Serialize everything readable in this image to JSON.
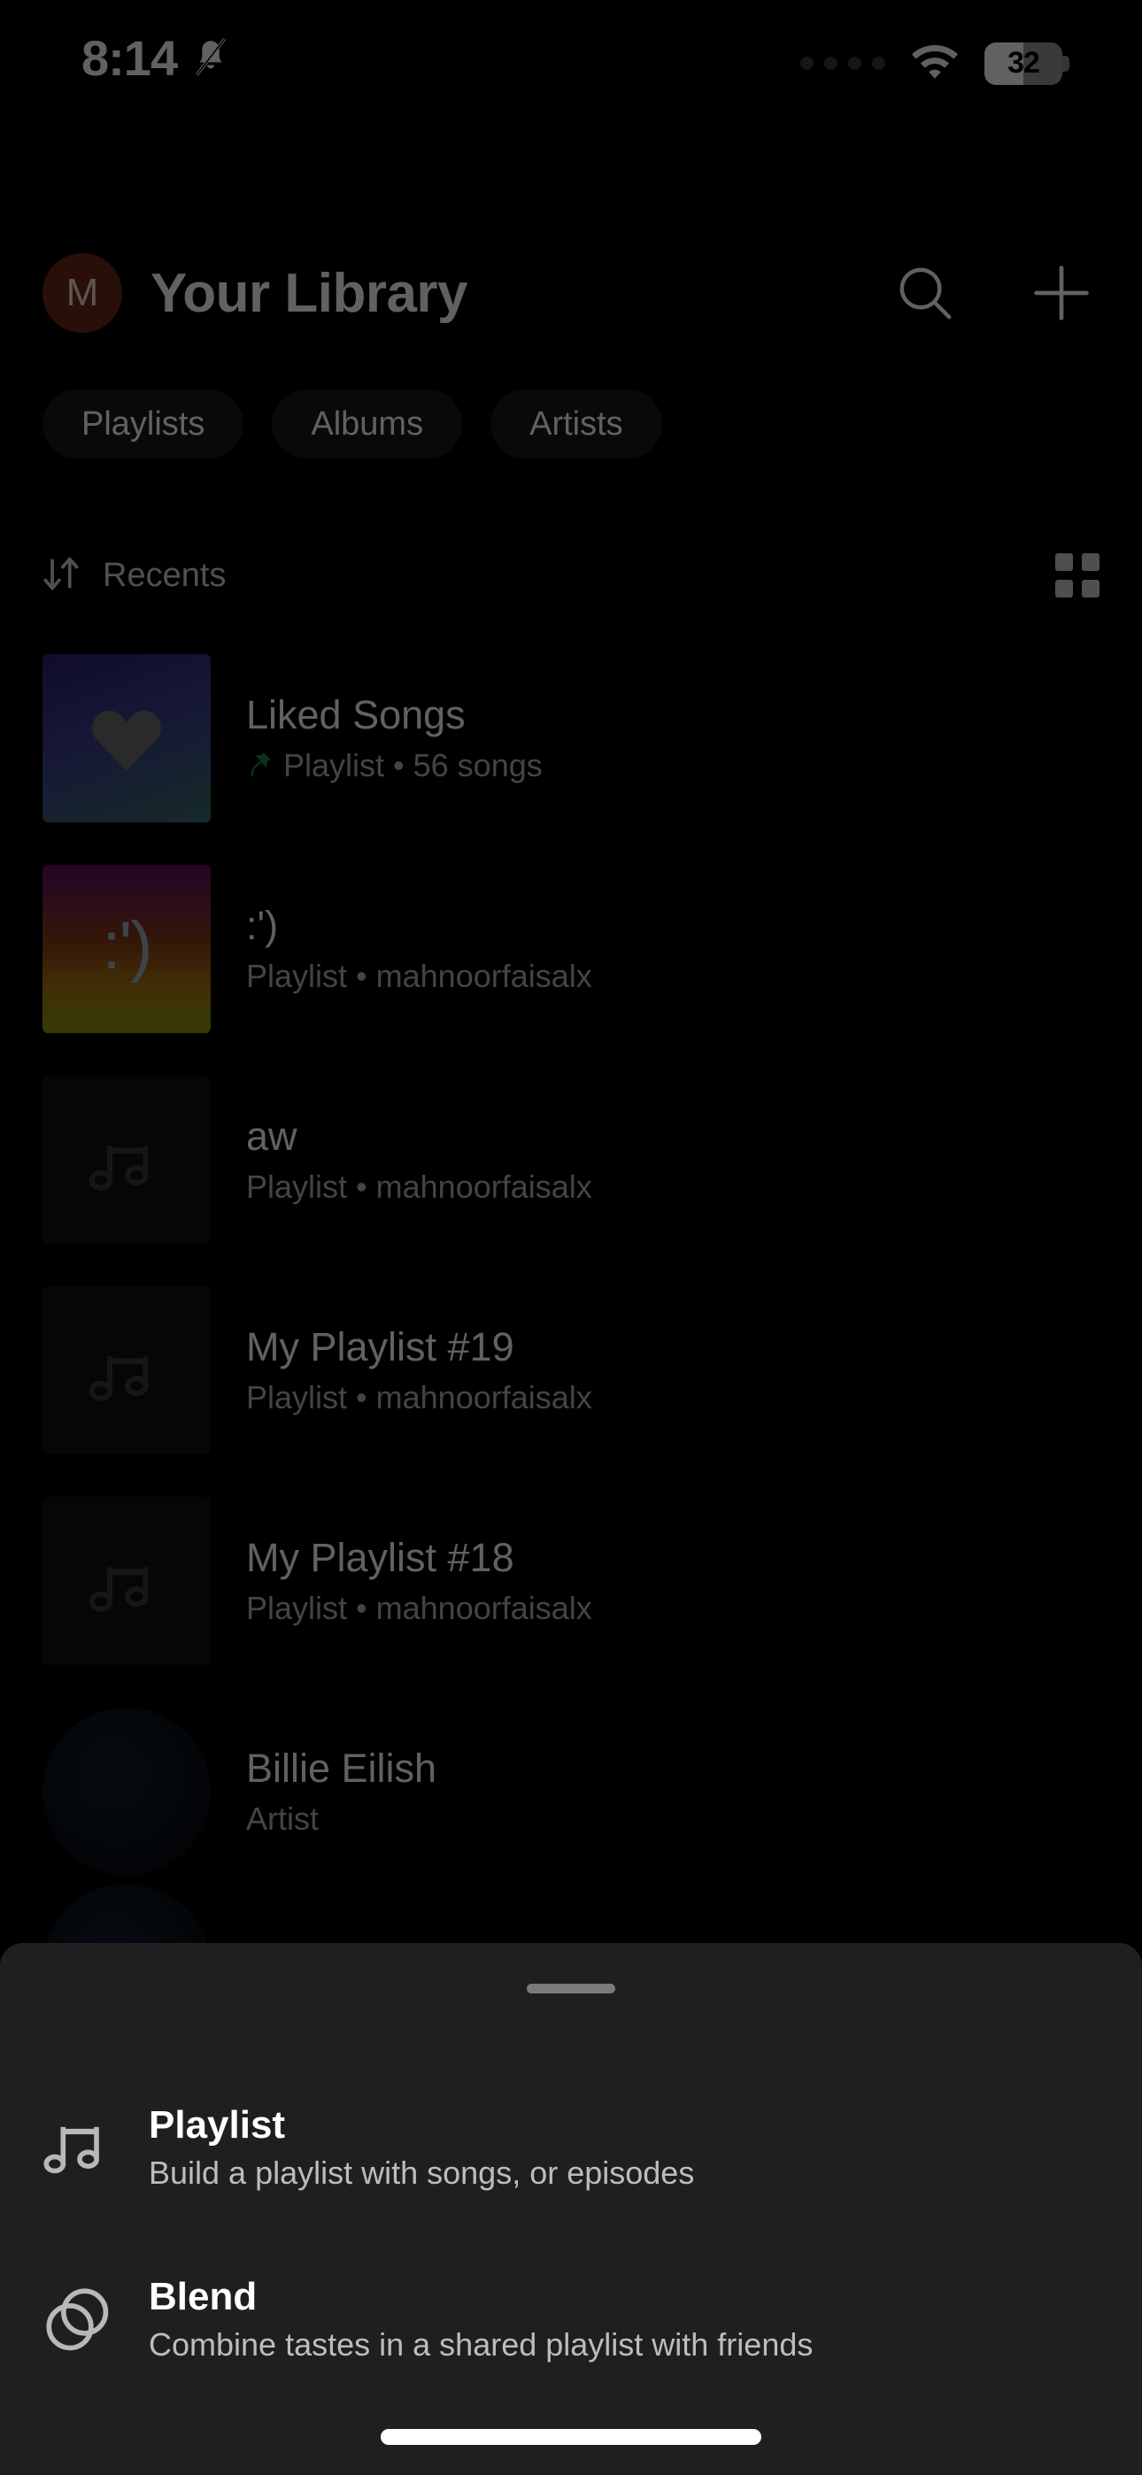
{
  "status_bar": {
    "time": "8:14",
    "bell_icon": "bell-muted-icon",
    "signal_icon": "signal-dots-icon",
    "wifi_icon": "wifi-icon",
    "battery_percent": "32"
  },
  "header": {
    "avatar_initial": "M",
    "avatar_color": "#6b2b18",
    "title": "Your Library",
    "search_icon": "search-icon",
    "add_icon": "plus-icon"
  },
  "filters": [
    {
      "label": "Playlists"
    },
    {
      "label": "Albums"
    },
    {
      "label": "Artists"
    }
  ],
  "sort": {
    "icon": "sort-arrows-icon",
    "label": "Recents",
    "view_toggle_icon": "grid-view-icon"
  },
  "library_items": [
    {
      "title": "Liked Songs",
      "subtitle": "Playlist • 56 songs",
      "pinned": true,
      "cover_type": "liked",
      "shape": "square",
      "cover_glyph": "heart-icon"
    },
    {
      "title": ":')",
      "subtitle": "Playlist • mahnoorfaisalx",
      "pinned": false,
      "cover_type": "smiley",
      "shape": "square",
      "cover_glyph": ":')"
    },
    {
      "title": "aw",
      "subtitle": "Playlist • mahnoorfaisalx",
      "pinned": false,
      "cover_type": "placeholder",
      "shape": "square",
      "cover_glyph": "music-note-icon"
    },
    {
      "title": "My Playlist #19",
      "subtitle": "Playlist • mahnoorfaisalx",
      "pinned": false,
      "cover_type": "placeholder",
      "shape": "square",
      "cover_glyph": "music-note-icon"
    },
    {
      "title": "My Playlist #18",
      "subtitle": "Playlist • mahnoorfaisalx",
      "pinned": false,
      "cover_type": "placeholder",
      "shape": "square",
      "cover_glyph": "music-note-icon"
    },
    {
      "title": "Billie Eilish",
      "subtitle": "Artist",
      "pinned": false,
      "cover_type": "artist",
      "shape": "circle",
      "cover_glyph": "artist-photo"
    }
  ],
  "sheet": {
    "grabber": "drag-handle",
    "options": [
      {
        "icon": "music-note-icon",
        "title": "Playlist",
        "description": "Build a playlist with songs, or episodes"
      },
      {
        "icon": "blend-circles-icon",
        "title": "Blend",
        "description": "Combine tastes in a shared playlist with friends"
      }
    ]
  },
  "colors": {
    "background": "#000000",
    "sheet_background": "#1f1f1f",
    "chip_background": "#181818",
    "text_primary": "#ffffff",
    "text_secondary": "#b3b3b3",
    "pin_green": "#1b8a3a"
  }
}
